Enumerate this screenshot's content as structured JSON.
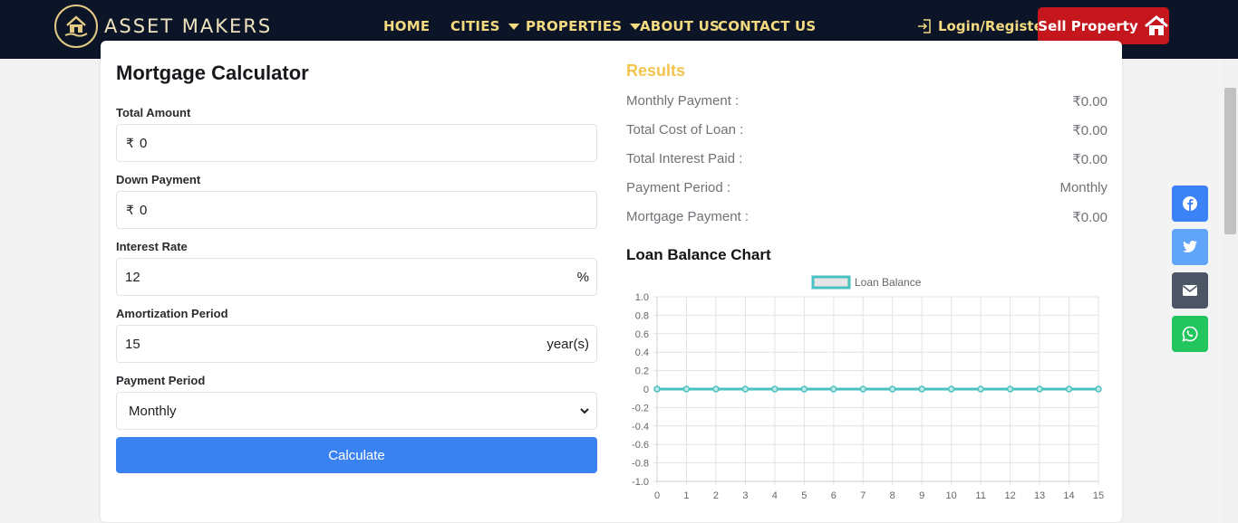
{
  "brand": {
    "name": "ASSET MAKERS"
  },
  "nav": {
    "home": "HOME",
    "cities": "CITIES",
    "properties": "PROPERTIES",
    "about": "ABOUT US",
    "contact": "CONTACT US",
    "login": "Login/Register",
    "sell": "Sell Property"
  },
  "calculator": {
    "title": "Mortgage Calculator",
    "total_amount": {
      "label": "Total Amount",
      "prefix": "₹",
      "value": "0"
    },
    "down_payment": {
      "label": "Down Payment",
      "prefix": "₹",
      "value": "0"
    },
    "interest_rate": {
      "label": "Interest Rate",
      "value": "12",
      "suffix": "%"
    },
    "amortization": {
      "label": "Amortization Period",
      "value": "15",
      "suffix": "year(s)"
    },
    "payment_period": {
      "label": "Payment Period",
      "value": "Monthly"
    },
    "calculate": "Calculate"
  },
  "results": {
    "title": "Results",
    "rows": [
      {
        "label": "Monthly Payment :",
        "value": "₹0.00"
      },
      {
        "label": "Total Cost of Loan :",
        "value": "₹0.00"
      },
      {
        "label": "Total Interest Paid :",
        "value": "₹0.00"
      },
      {
        "label": "Payment Period :",
        "value": "Monthly"
      },
      {
        "label": "Mortgage Payment :",
        "value": "₹0.00"
      }
    ]
  },
  "chart_section": {
    "title": "Loan Balance Chart"
  },
  "chart_data": {
    "type": "line",
    "title": "",
    "xlabel": "",
    "ylabel": "",
    "x": [
      0,
      1,
      2,
      3,
      4,
      5,
      6,
      7,
      8,
      9,
      10,
      11,
      12,
      13,
      14,
      15
    ],
    "series": [
      {
        "name": "Loan Balance",
        "values": [
          0,
          0,
          0,
          0,
          0,
          0,
          0,
          0,
          0,
          0,
          0,
          0,
          0,
          0,
          0,
          0
        ],
        "color": "#4bc0c0"
      }
    ],
    "y_ticks": [
      "1.0",
      "0.8",
      "0.6",
      "0.4",
      "0.2",
      "0",
      "-0.2",
      "-0.4",
      "-0.6",
      "-0.8",
      "-1.0"
    ],
    "ylim": [
      -1,
      1
    ],
    "xlim": [
      0,
      15
    ],
    "grid": true,
    "legend": "top-center"
  },
  "colors": {
    "header_bg": "#0c1528",
    "nav_text": "#f3d980",
    "sell_button": "#c4161c",
    "calculate_button": "#3a82f2",
    "results_title": "#f4c44d",
    "facebook": "#3b82f6",
    "twitter": "#60a5fa",
    "email": "#4b5563",
    "whatsapp": "#22c55e"
  },
  "social": [
    {
      "icon": "facebook-icon"
    },
    {
      "icon": "twitter-icon"
    },
    {
      "icon": "email-icon"
    },
    {
      "icon": "whatsapp-icon"
    }
  ]
}
